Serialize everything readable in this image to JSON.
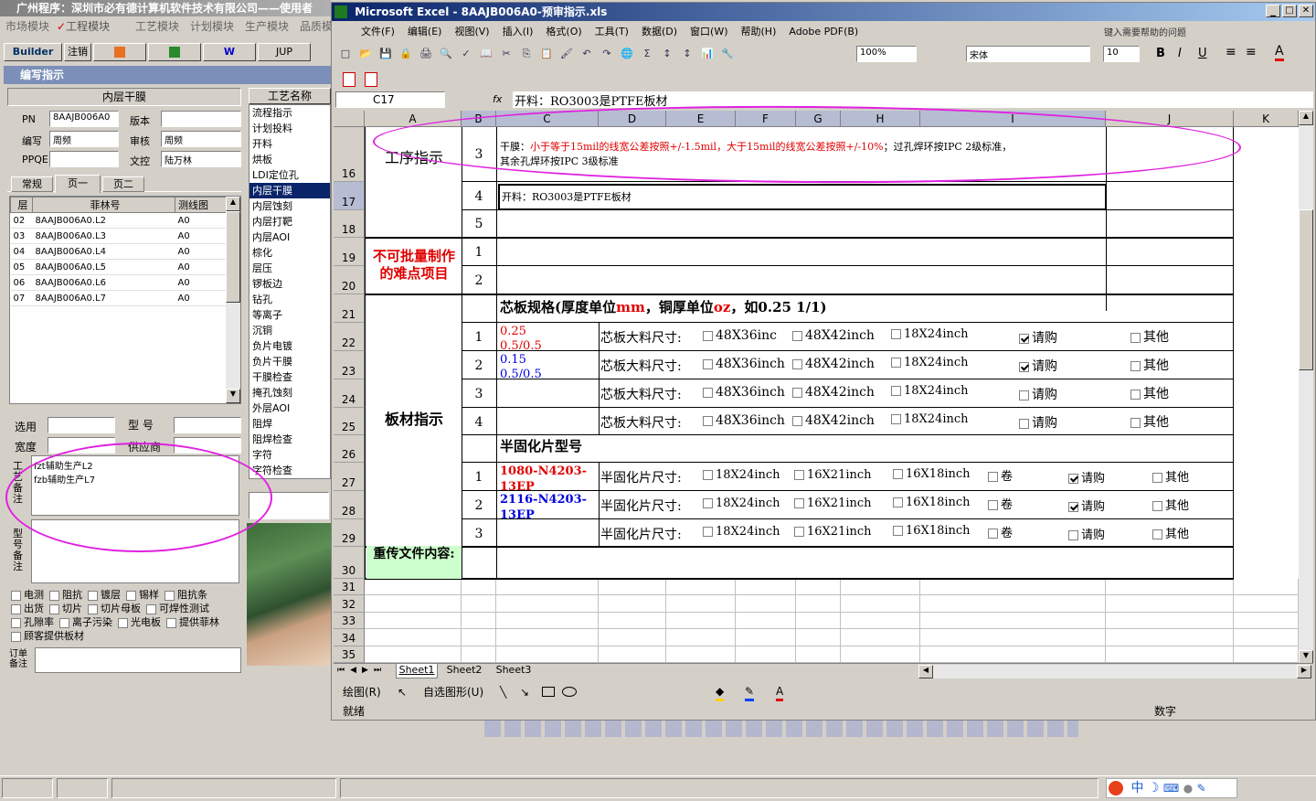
{
  "app": {
    "title": "广州程序：深圳市必有德计算机软件技术有限公司——使用者",
    "module_tabs": [
      "市场模块",
      "工程模块",
      "工艺模块",
      "计划模块",
      "生产模块",
      "品质模"
    ],
    "builder_tabs": [
      "Builder",
      "注销",
      "W",
      "JUP"
    ]
  },
  "editor": {
    "title": "编写指示",
    "group": "内层干膜",
    "labels": {
      "pn": "PN",
      "version": "版本",
      "editor": "编写",
      "review": "审核",
      "ppqe": "PPQE",
      "doc": "文控"
    },
    "values": {
      "pn": "8AAJB006A0",
      "editor": "周频",
      "review": "周频",
      "doc": "陆万林"
    },
    "tabs": [
      "常规",
      "页一",
      "页二"
    ],
    "grid_headers": [
      "层",
      "菲林号",
      "测线图"
    ],
    "grid_rows": [
      [
        "02",
        "8AAJB006A0.L2",
        "A0"
      ],
      [
        "03",
        "8AAJB006A0.L3",
        "A0"
      ],
      [
        "04",
        "8AAJB006A0.L4",
        "A0"
      ],
      [
        "05",
        "8AAJB006A0.L5",
        "A0"
      ],
      [
        "06",
        "8AAJB006A0.L6",
        "A0"
      ],
      [
        "07",
        "8AAJB006A0.L7",
        "A0"
      ]
    ],
    "select_label": "选用",
    "model_label": "型 号",
    "width_label": "宽度",
    "supply_label": "供应商",
    "process_note_label": "工艺备注",
    "process_note_lines": [
      "fzt辅助生产L2",
      "fzb辅助生产L7"
    ],
    "type_note_label": "型号备注",
    "order_note_label": "订单备注",
    "checks": [
      [
        "电测",
        "阻抗",
        "镀层",
        "锡样",
        "阻抗条"
      ],
      [
        "出货",
        "切片",
        "切片母板",
        "可焊性测试"
      ],
      [
        "孔隙率",
        "离子污染",
        "光电板",
        "提供菲林"
      ],
      [
        "顾客提供板材"
      ]
    ]
  },
  "process_list": {
    "header": "工艺名称",
    "items": [
      "流程指示",
      "计划投料",
      "开料",
      "烘板",
      "LDI定位孔",
      "内层干膜",
      "内层蚀刻",
      "内层打靶",
      "内层AOI",
      "棕化",
      "层压",
      "锣板边",
      "钻孔",
      "等离子",
      "沉铜",
      "负片电镀",
      "负片干膜",
      "干膜检查",
      "掩孔蚀刻",
      "外层AOI",
      "阻焊",
      "阻焊检查",
      "字符",
      "字符检查"
    ],
    "selected": "内层干膜"
  },
  "excel": {
    "title": "Microsoft Excel - 8AAJB006A0-预审指示.xls",
    "menu": [
      "文件(F)",
      "编辑(E)",
      "视图(V)",
      "插入(I)",
      "格式(O)",
      "工具(T)",
      "数据(D)",
      "窗口(W)",
      "帮助(H)",
      "Adobe PDF(B)"
    ],
    "help_placeholder": "键入需要帮助的问题",
    "font": "宋体",
    "size": "10",
    "zoom": "100%",
    "name_box": "C17",
    "fx": "fx",
    "formula": "开料：RO3003是PTFE板材",
    "columns": [
      "A",
      "B",
      "C",
      "D",
      "E",
      "F",
      "G",
      "H",
      "I",
      "J",
      "K"
    ],
    "rows": [
      "16",
      "17",
      "18",
      "19",
      "20",
      "21",
      "22",
      "23",
      "24",
      "25",
      "26",
      "27",
      "28",
      "29",
      "30",
      "31",
      "32",
      "33",
      "34",
      "35"
    ],
    "sheets": [
      "Sheet1",
      "Sheet2",
      "Sheet3"
    ],
    "draw_label": "绘图(R)",
    "autoshape_label": "自选图形(U)",
    "status": "就绪",
    "status_right": "数字"
  },
  "sheet": {
    "process_instr": "工序指示",
    "difficult": "不可批量制作的难点项目",
    "board_instr": "板材指示",
    "reupload": "重传文件内容:",
    "n3": "3",
    "n4": "4",
    "n5": "5",
    "n1": "1",
    "n2": "2",
    "r16_black1": "干膜：",
    "r16_red": "小于等于15mil的线宽公差按照+/-1.5mil，大于15mil的线宽公差按照+/-10%",
    "r16_black2": "；过孔焊环按IPC 2级标准，",
    "r16_line2": "其余孔焊环按IPC 3级标准",
    "r17": "开料：RO3003是PTFE板材",
    "core_title_a": "芯板规格(厚度单位",
    "core_mm": "mm",
    "core_title_b": "，铜厚单位",
    "core_oz": "oz",
    "core_title_c": "，如0.25 1/1)",
    "core_rows": [
      {
        "n": "1",
        "v1": "0.25",
        "v2": "0.5/0.5",
        "color": "#e00000",
        "label": "芯板大料尺寸:",
        "o1": "48X36inc",
        "o2": "48X42inch",
        "o3": "18X24inch",
        "buy": "请购",
        "buy_on": true,
        "other": "其他"
      },
      {
        "n": "2",
        "v1": "0.15",
        "v2": "0.5/0.5",
        "color": "#0000e0",
        "label": "芯板大料尺寸:",
        "o1": "48X36inch",
        "o2": "48X42inch",
        "o3": "18X24inch",
        "buy": "请购",
        "buy_on": true,
        "other": "其他"
      },
      {
        "n": "3",
        "v1": "",
        "v2": "",
        "color": "#000",
        "label": "芯板大料尺寸:",
        "o1": "48X36inch",
        "o2": "48X42inch",
        "o3": "18X24inch",
        "buy": "请购",
        "buy_on": false,
        "other": "其他"
      },
      {
        "n": "4",
        "v1": "",
        "v2": "",
        "color": "#000",
        "label": "芯板大料尺寸:",
        "o1": "48X36inch",
        "o2": "48X42inch",
        "o3": "18X24inch",
        "buy": "请购",
        "buy_on": false,
        "other": "其他"
      }
    ],
    "pp_title": "半固化片型号",
    "pp_rows": [
      {
        "n": "1",
        "v1": "1080-N4203-",
        "v2": "13EP",
        "color": "#e00000",
        "label": "半固化片尺寸:",
        "o1": "18X24inch",
        "o2": "16X21inch",
        "o3": "16X18inch",
        "roll": "卷",
        "buy": "请购",
        "buy_on": true,
        "other": "其他"
      },
      {
        "n": "2",
        "v1": "2116-N4203-",
        "v2": "13EP",
        "color": "#0000e0",
        "label": "半固化片尺寸:",
        "o1": "18X24inch",
        "o2": "16X21inch",
        "o3": "16X18inch",
        "roll": "卷",
        "buy": "请购",
        "buy_on": true,
        "other": "其他"
      },
      {
        "n": "3",
        "v1": "",
        "v2": "",
        "color": "#000",
        "label": "半固化片尺寸:",
        "o1": "18X24inch",
        "o2": "16X21inch",
        "o3": "16X18inch",
        "roll": "卷",
        "buy": "请购",
        "buy_on": false,
        "other": "其他"
      }
    ]
  },
  "taskbar": {
    "ime": "中"
  },
  "colors": {
    "title_active": "#0a246a",
    "title_inactive": "#808080",
    "red": "#e00000",
    "blue": "#0000e0",
    "ellipse": "#e020e0",
    "panel_header": "#7b8fb8"
  }
}
